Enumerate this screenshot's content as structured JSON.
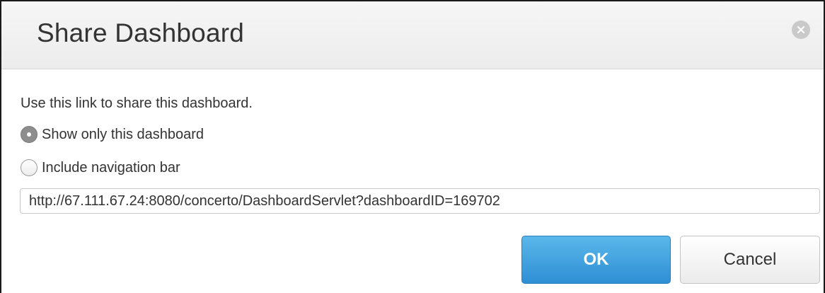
{
  "dialog": {
    "title": "Share Dashboard",
    "close_icon": "close-circle-icon"
  },
  "body": {
    "description": "Use this link to share this dashboard.",
    "options": [
      {
        "label": "Show only this dashboard",
        "selected": true
      },
      {
        "label": "Include navigation bar",
        "selected": false
      }
    ],
    "link_value": "http://67.111.67.24:8080/concerto/DashboardServlet?dashboardID=169702"
  },
  "buttons": {
    "ok_label": "OK",
    "cancel_label": "Cancel"
  },
  "colors": {
    "primary_button": "#3a9ee0",
    "header_background": "#efefef",
    "text": "#333333"
  }
}
